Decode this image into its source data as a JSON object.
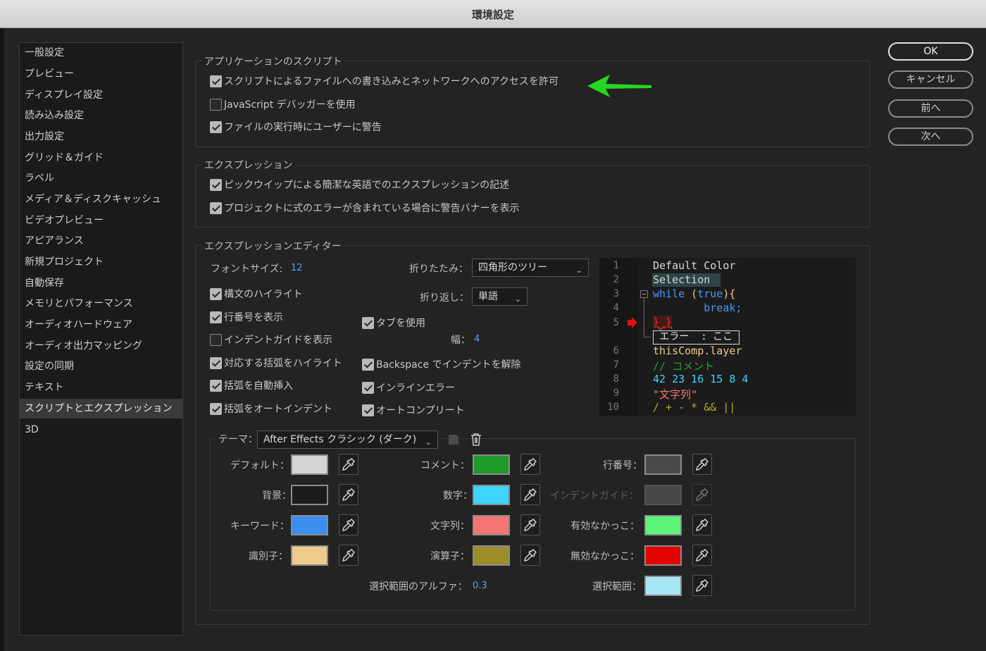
{
  "window": {
    "title": "環境設定"
  },
  "sidebar": {
    "items": [
      {
        "label": "一般設定",
        "name": "general"
      },
      {
        "label": "プレビュー",
        "name": "preview"
      },
      {
        "label": "ディスプレイ設定",
        "name": "display"
      },
      {
        "label": "読み込み設定",
        "name": "import"
      },
      {
        "label": "出力設定",
        "name": "output"
      },
      {
        "label": "グリッド＆ガイド",
        "name": "grid-guides"
      },
      {
        "label": "ラベル",
        "name": "labels"
      },
      {
        "label": "メディア＆ディスクキャッシュ",
        "name": "media-disk-cache"
      },
      {
        "label": "ビデオプレビュー",
        "name": "video-preview"
      },
      {
        "label": "アピアランス",
        "name": "appearance"
      },
      {
        "label": "新規プロジェクト",
        "name": "new-project"
      },
      {
        "label": "自動保存",
        "name": "auto-save"
      },
      {
        "label": "メモリとパフォーマンス",
        "name": "memory-performance"
      },
      {
        "label": "オーディオハードウェア",
        "name": "audio-hardware"
      },
      {
        "label": "オーディオ出力マッピング",
        "name": "audio-output-mapping"
      },
      {
        "label": "設定の同期",
        "name": "sync-settings"
      },
      {
        "label": "テキスト",
        "name": "text"
      },
      {
        "label": "スクリプトとエクスプレッション",
        "name": "scripts-expressions",
        "active": true
      },
      {
        "label": "3D",
        "name": "3d"
      }
    ]
  },
  "buttons": {
    "ok": "OK",
    "cancel": "キャンセル",
    "prev": "前へ",
    "next": "次へ"
  },
  "app_scripts": {
    "legend": "アプリケーションのスクリプト",
    "options": [
      {
        "label": "スクリプトによるファイルへの書き込みとネットワークへのアクセスを許可",
        "checked": true
      },
      {
        "label": "JavaScript デバッガーを使用",
        "checked": false
      },
      {
        "label": "ファイルの実行時にユーザーに警告",
        "checked": true
      }
    ]
  },
  "expressions": {
    "legend": "エクスプレッション",
    "options": [
      {
        "label": "ピックウイップによる簡潔な英語でのエクスプレッションの記述",
        "checked": true
      },
      {
        "label": "プロジェクトに式のエラーが含まれている場合に警告バナーを表示",
        "checked": true
      }
    ]
  },
  "editor": {
    "legend": "エクスプレッションエディター",
    "font_size_label": "フォントサイズ:",
    "font_size_value": "12",
    "fold_label": "折りたたみ：",
    "fold_value": "四角形のツリー",
    "wrap_label": "折り返し：",
    "wrap_value": "単語",
    "tab_width_label": "幅：",
    "tab_width_value": "4",
    "left_options": [
      {
        "label": "構文のハイライト",
        "checked": true
      },
      {
        "label": "行番号を表示",
        "checked": true
      },
      {
        "label": "インデントガイドを表示",
        "checked": false
      },
      {
        "label": "対応する括弧をハイライト",
        "checked": true
      },
      {
        "label": "括弧を自動挿入",
        "checked": true
      },
      {
        "label": "括弧をオートインデント",
        "checked": true
      }
    ],
    "right_options": [
      {
        "label": "タブを使用",
        "checked": true
      },
      {
        "label": "Backspace でインデントを解除",
        "checked": true
      },
      {
        "label": "インラインエラー",
        "checked": true
      },
      {
        "label": "オートコンプリート",
        "checked": true
      }
    ],
    "preview": {
      "line_numbers": [
        "1",
        "2",
        "3",
        "4",
        "5",
        "6",
        "7",
        "8",
        "9",
        "10"
      ],
      "lines": {
        "l1": "Default Color",
        "l2": "Selection",
        "l3_kw": "while",
        "l3_a": " (",
        "l3_b": "true",
        "l3_c": "){",
        "l4": "        break;",
        "l5": "} }",
        "error": " エラー  : ここ ",
        "l6": "thisComp.layer",
        "l7": "// コメント",
        "l8": "42 23 16 15 8 4",
        "l9": "\"文字列\"",
        "l10": "/ + - * && ||"
      }
    }
  },
  "theme": {
    "label": "テーマ：",
    "value": "After Effects クラシック (ダーク)",
    "colors": [
      {
        "label": "デフォルト：",
        "name": "default",
        "color": "#d4d4d4"
      },
      {
        "label": "背景：",
        "name": "background",
        "color": "#1c1c1c"
      },
      {
        "label": "キーワード：",
        "name": "keyword",
        "color": "#3a8ff0"
      },
      {
        "label": "識別子：",
        "name": "identifier",
        "color": "#efcb8b"
      },
      {
        "label": "コメント：",
        "name": "comment",
        "color": "#1e9a2a"
      },
      {
        "label": "数字：",
        "name": "number",
        "color": "#3fd3ff"
      },
      {
        "label": "文字列：",
        "name": "string",
        "color": "#f57575"
      },
      {
        "label": "演算子：",
        "name": "operator",
        "color": "#9a8d2a"
      },
      {
        "label": "行番号：",
        "name": "line-number",
        "color": "#4a4a4a"
      },
      {
        "label": "インデントガイド：",
        "name": "indent-guide",
        "color": "#474747",
        "disabled": true
      },
      {
        "label": "有効なかっこ：",
        "name": "valid-bracket",
        "color": "#5cf57a"
      },
      {
        "label": "無効なかっこ：",
        "name": "invalid-bracket",
        "color": "#e30000"
      },
      {
        "label": "選択範囲：",
        "name": "selection",
        "color": "#a6e6f5"
      }
    ],
    "alpha_label": "選択範囲のアルファ：",
    "alpha_value": "0.3"
  },
  "colors": {
    "arrow": "#22d822",
    "accent": "#4aa3ff"
  }
}
